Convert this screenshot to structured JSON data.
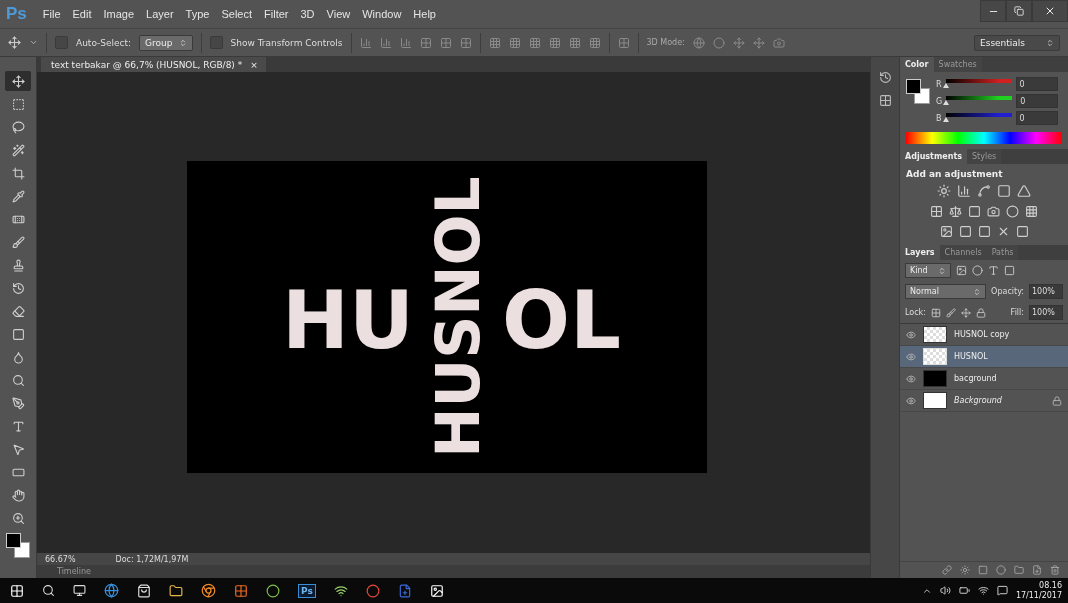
{
  "app": {
    "logo": "Ps",
    "menu": [
      "File",
      "Edit",
      "Image",
      "Layer",
      "Type",
      "Select",
      "Filter",
      "3D",
      "View",
      "Window",
      "Help"
    ]
  },
  "options_bar": {
    "auto_select": {
      "label": "Auto-Select:",
      "checked": false
    },
    "target": "Group",
    "show_transform": {
      "label": "Show Transform Controls",
      "checked": false
    },
    "mode_label": "3D Mode:",
    "workspace": "Essentials"
  },
  "tools": [
    {
      "kind": "move",
      "selected": true
    },
    {
      "kind": "marquee",
      "selected": false
    },
    {
      "kind": "lasso",
      "selected": false
    },
    {
      "kind": "wand",
      "selected": false
    },
    {
      "kind": "crop",
      "selected": false
    },
    {
      "kind": "eyedropper",
      "selected": false
    },
    {
      "kind": "heal",
      "selected": false
    },
    {
      "kind": "brush",
      "selected": false
    },
    {
      "kind": "stamp",
      "selected": false
    },
    {
      "kind": "history",
      "selected": false
    },
    {
      "kind": "eraser",
      "selected": false
    },
    {
      "kind": "gradient",
      "selected": false
    },
    {
      "kind": "blur",
      "selected": false
    },
    {
      "kind": "dodge",
      "selected": false
    },
    {
      "kind": "pen",
      "selected": false
    },
    {
      "kind": "type",
      "selected": false
    },
    {
      "kind": "path",
      "selected": false
    },
    {
      "kind": "shape",
      "selected": false
    },
    {
      "kind": "hand",
      "selected": false
    },
    {
      "kind": "zoom",
      "selected": false
    }
  ],
  "document": {
    "tab": "text terbakar @ 66,7% (HUSNOL, RGB/8) *",
    "close": "×",
    "canvas_texts": [
      {
        "kind": "horizontal",
        "text": "HU"
      },
      {
        "kind": "vertical",
        "text": "HUSNOL"
      },
      {
        "kind": "horizontal",
        "text": "OL"
      }
    ],
    "zoom": "66.67%",
    "doc_size": "Doc: 1,72M/1,97M",
    "timeline": "Timeline"
  },
  "color_panel": {
    "tabs": [
      {
        "label": "Color",
        "selected": true
      },
      {
        "label": "Swatches",
        "selected": false
      }
    ],
    "sliders": [
      {
        "label": "R",
        "value": "0",
        "level": 0,
        "color": "#d02020"
      },
      {
        "label": "G",
        "value": "0",
        "level": 0,
        "color": "#20d020"
      },
      {
        "label": "B",
        "value": "0",
        "level": 0,
        "color": "#2020d0"
      }
    ]
  },
  "adjustments_panel": {
    "tabs": [
      {
        "label": "Adjustments",
        "selected": true
      },
      {
        "label": "Styles",
        "selected": false
      }
    ],
    "heading": "Add an adjustment"
  },
  "layers_panel": {
    "tabs": [
      {
        "label": "Layers",
        "selected": true
      },
      {
        "label": "Channels",
        "selected": false
      },
      {
        "label": "Paths",
        "selected": false
      }
    ],
    "filter": "Kind",
    "blend_mode": "Normal",
    "opacity_label": "Opacity:",
    "opacity": "100%",
    "lock_label": "Lock:",
    "fill_label": "Fill:",
    "fill": "100%",
    "layers": [
      {
        "name": "HUSNOL copy",
        "kind": "transparent",
        "visible": true,
        "selected": false,
        "locked": false
      },
      {
        "name": "HUSNOL",
        "kind": "transparent",
        "visible": true,
        "selected": true,
        "locked": false
      },
      {
        "name": "bacground",
        "kind": "black",
        "visible": true,
        "selected": false,
        "locked": false
      },
      {
        "name": "Background",
        "kind": "white",
        "visible": true,
        "selected": false,
        "locked": true
      }
    ]
  },
  "taskbar": {
    "ps_label": "Ps",
    "time": "08.16",
    "date": "17/11/2017"
  }
}
